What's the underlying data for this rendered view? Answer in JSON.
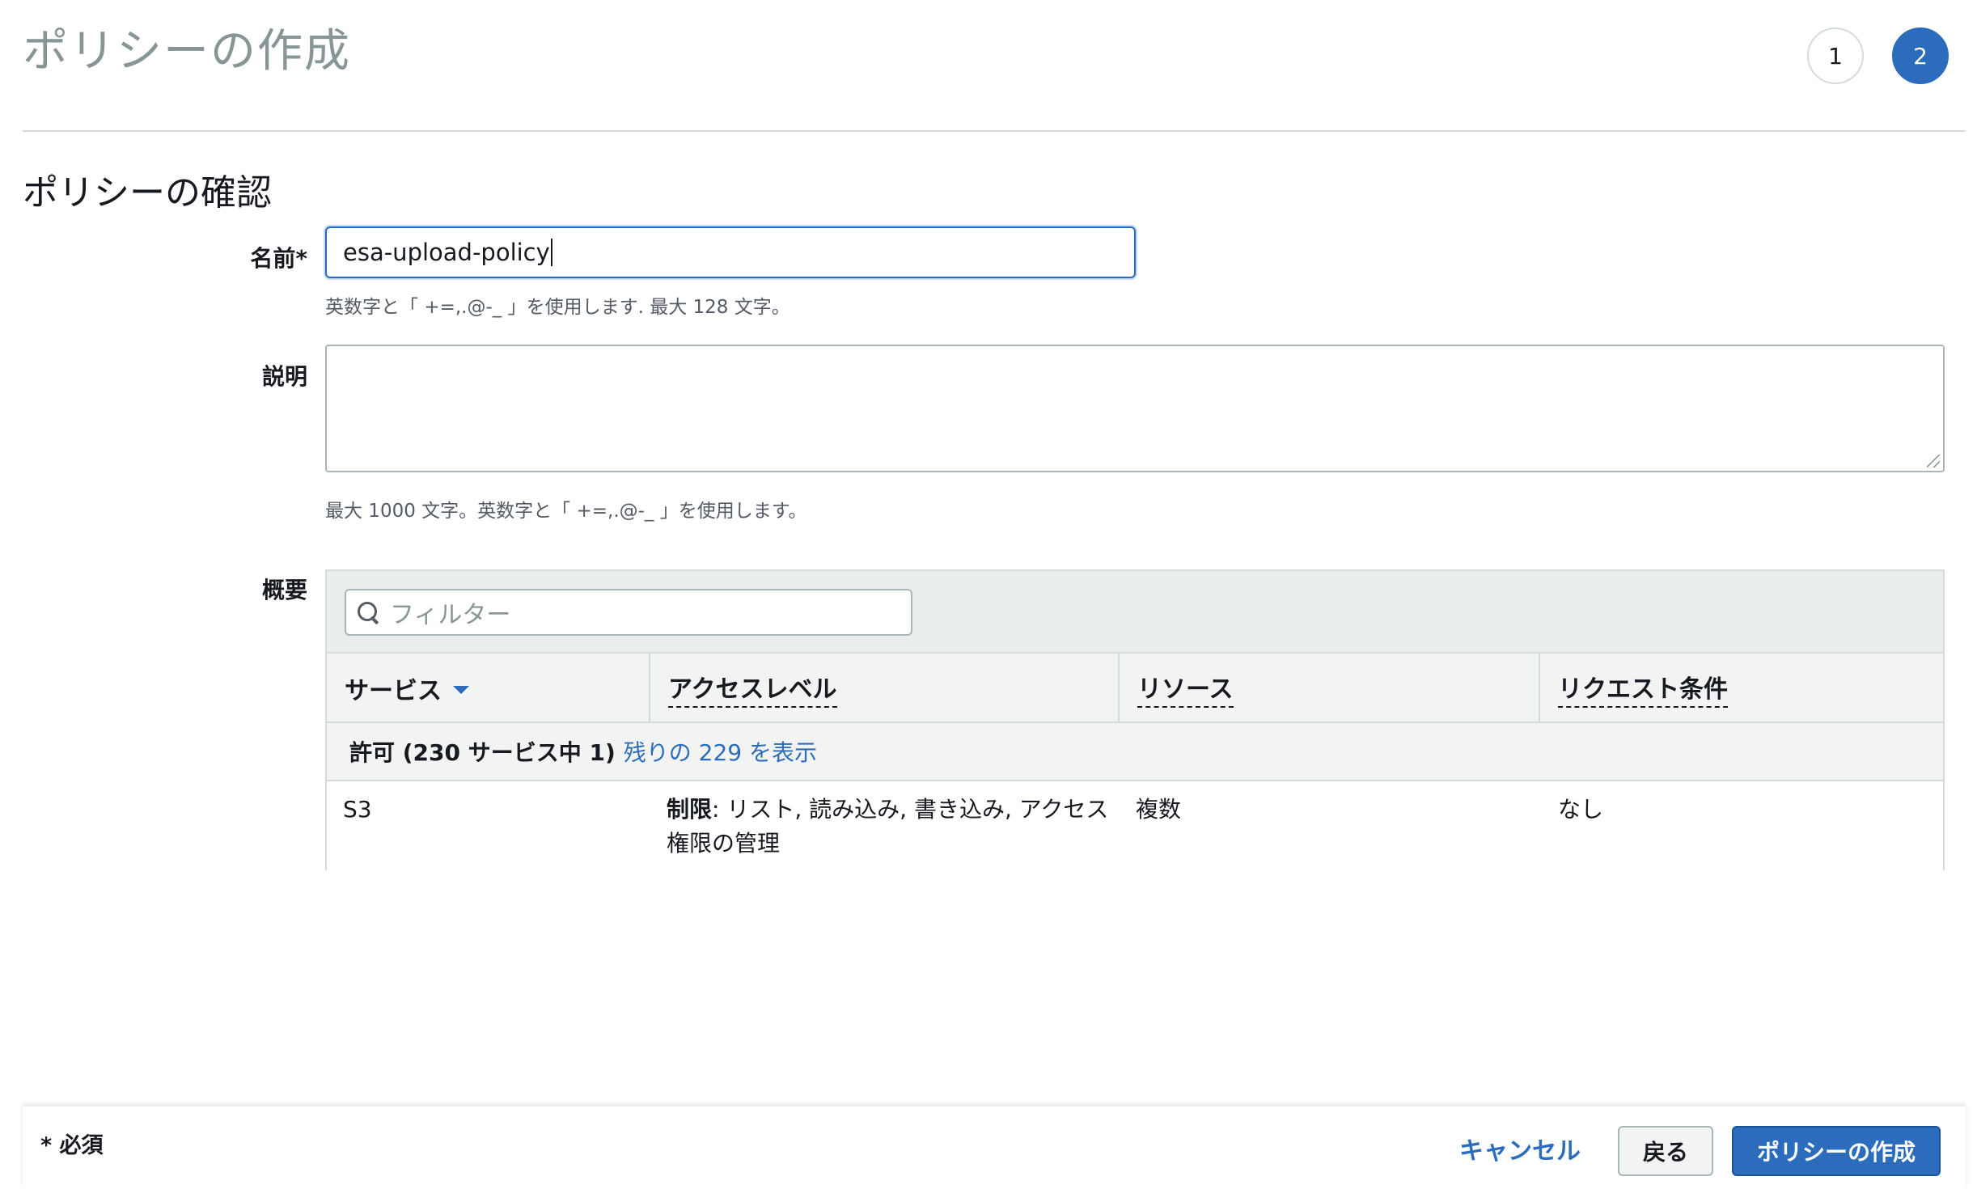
{
  "header": {
    "title": "ポリシーの作成",
    "steps": [
      "1",
      "2"
    ],
    "current_step": 2
  },
  "review": {
    "section_title": "ポリシーの確認",
    "name": {
      "label": "名前*",
      "value": "esa-upload-policy",
      "hint": "英数字と「 +=,.@-_ 」を使用します. 最大 128 文字。"
    },
    "description": {
      "label": "説明",
      "value": "",
      "hint": "最大 1000 文字。英数字と「 +=,.@-_ 」を使用します。"
    },
    "summary": {
      "label": "概要",
      "filter_placeholder": "フィルター",
      "columns": [
        "サービス",
        "アクセスレベル",
        "リソース",
        "リクエスト条件"
      ],
      "group": {
        "label": "許可 (230 サービス中 1)",
        "show_rest_link": "残りの 229 を表示"
      },
      "rows": [
        {
          "service": "S3",
          "access_level_prefix": "制限",
          "access_level_line1": ": リスト, 読み込み, 書き込み, アクセス",
          "access_level_line2": "権限の管理",
          "resource": "複数",
          "request_condition": "なし"
        }
      ]
    }
  },
  "footer": {
    "required_note": "* 必須",
    "cancel_label": "キャンセル",
    "back_label": "戻る",
    "create_label": "ポリシーの作成"
  },
  "colors": {
    "accent": "#2b6cbc",
    "muted_title": "#879596",
    "border": "#d5dbdb"
  }
}
